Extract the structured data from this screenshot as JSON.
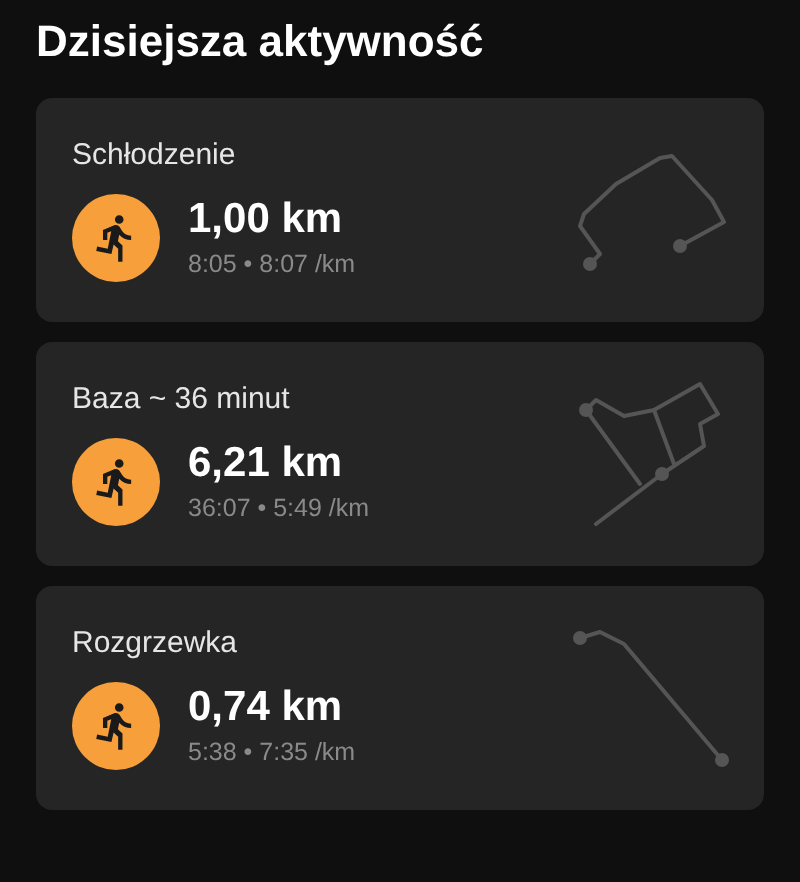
{
  "title": "Dzisiejsza aktywność",
  "activities": [
    {
      "name": "Schłodzenie",
      "distance": "1,00 km",
      "stats": "8:05 • 8:07 /km"
    },
    {
      "name": "Baza ~ 36 minut",
      "distance": "6,21 km",
      "stats": "36:07 • 5:49 /km"
    },
    {
      "name": "Rozgrzewka",
      "distance": "0,74 km",
      "stats": "5:38 • 7:35 /km"
    }
  ]
}
